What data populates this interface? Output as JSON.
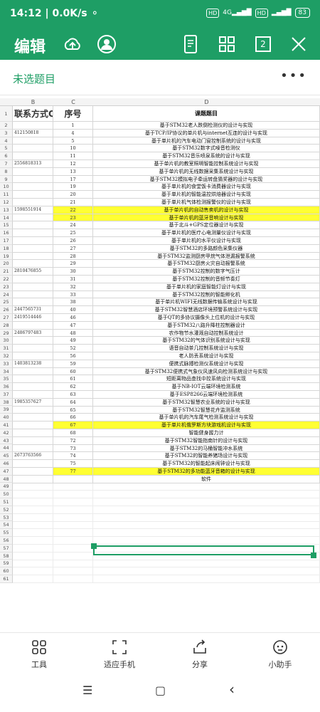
{
  "status": {
    "time": "14:12",
    "speed": "0.0K/s",
    "net1": "HD",
    "net2": "HD",
    "signal": "4G",
    "battery": "83"
  },
  "toolbar": {
    "title": "编辑",
    "page_count": "2"
  },
  "subbar": {
    "title": "未选题目",
    "more": "•••"
  },
  "columns": {
    "B": "B",
    "C": "C",
    "D": "D"
  },
  "row_numbers": [
    "1",
    "2",
    "3",
    "4",
    "5",
    "6",
    "7",
    "8",
    "9",
    "10",
    "11",
    "12",
    "13",
    "14",
    "15",
    "16",
    "17",
    "18",
    "19",
    "20",
    "21",
    "22",
    "23",
    "24",
    "25",
    "26",
    "27",
    "28",
    "29",
    "30",
    "31",
    "32",
    "33",
    "34",
    "35",
    "36",
    "37",
    "38",
    "39",
    "40",
    "41",
    "42",
    "43",
    "44",
    "45",
    "46",
    "47",
    "48",
    "49",
    "50",
    "51",
    "52",
    "53",
    "54",
    "55",
    "56",
    "57",
    "58",
    "59",
    "60",
    "61"
  ],
  "header": {
    "qq": "联系方式QQ",
    "seq": "序号",
    "topic": "课题题目"
  },
  "rows": [
    {
      "qq": "",
      "seq": "1",
      "topic": "基于STM32老人跌倒检测仪的设计与实现",
      "hl": false
    },
    {
      "qq": "412150818",
      "seq": "4",
      "topic": "基于TCP/IP协议的单片机与internet互连的设计与实现",
      "hl": false
    },
    {
      "qq": "",
      "seq": "5",
      "topic": "基于单片机的汽车电动门窗控制系统的设计与实现",
      "hl": false
    },
    {
      "qq": "",
      "seq": "10",
      "topic": "基于STM32数字式噪音检测仪",
      "hl": false
    },
    {
      "qq": "",
      "seq": "11",
      "topic": "基于STM32音乐喷泉系统的设计与实现",
      "hl": false
    },
    {
      "qq": "2556818313",
      "seq": "12",
      "topic": "基于单片机的教室照明智能控制系统设计与实现",
      "hl": false
    },
    {
      "qq": "",
      "seq": "13",
      "topic": "基于单片机的无线数据采集系统设计与实现",
      "hl": false
    },
    {
      "qq": "",
      "seq": "17",
      "topic": "基于STM32模拟电子牵运转盘猜奖器的设计与实现",
      "hl": false
    },
    {
      "qq": "",
      "seq": "19",
      "topic": "基于单片机的食堂饭卡消费器设计与实现",
      "hl": false
    },
    {
      "qq": "",
      "seq": "20",
      "topic": "基于单片机的智能温控烘焙器设计与实现",
      "hl": false
    },
    {
      "qq": "",
      "seq": "21",
      "topic": "基于单片机气体检测报警仪的设计与实现",
      "hl": false
    },
    {
      "qq": "1598551914",
      "seq": "22",
      "topic": "基于单片机的自动售卖机的设计与实现",
      "hl": true
    },
    {
      "qq": "",
      "seq": "23",
      "topic": "基于单片机的蓝牙音响设计与实现",
      "hl": true
    },
    {
      "qq": "",
      "seq": "24",
      "topic": "基于北斗+GPS定位器设计与实现",
      "hl": false
    },
    {
      "qq": "",
      "seq": "25",
      "topic": "基于单片机的医疗心电测量仪设计与实现",
      "hl": false
    },
    {
      "qq": "",
      "seq": "26",
      "topic": "基于单片机的水平仪设计与实现",
      "hl": false
    },
    {
      "qq": "",
      "seq": "27",
      "topic": "基于STM32的多路颜色采集仪器",
      "hl": false
    },
    {
      "qq": "",
      "seq": "28",
      "topic": "基于STM32监测厨房甲烷气体泄漏报警系统",
      "hl": false
    },
    {
      "qq": "",
      "seq": "29",
      "topic": "基于STM32厨房火灾自动报警系统",
      "hl": false
    },
    {
      "qq": "2810476855",
      "seq": "30",
      "topic": "基于STM32控制的数字气压计",
      "hl": false
    },
    {
      "qq": "",
      "seq": "31",
      "topic": "基于STM32控制的音频节奏灯",
      "hl": false
    },
    {
      "qq": "",
      "seq": "32",
      "topic": "基于单片机的家庭智能灯设计与实现",
      "hl": false
    },
    {
      "qq": "",
      "seq": "33",
      "topic": "基于STM32控制的智能孵化机",
      "hl": false
    },
    {
      "qq": "",
      "seq": "38",
      "topic": "基于单片机WIFI无线数据传输系统设计与实现",
      "hl": false
    },
    {
      "qq": "2447565731",
      "seq": "40",
      "topic": "基于STM32智慧酒店环境预警系统设计与实现",
      "hl": false
    },
    {
      "qq": "2419514446",
      "seq": "46",
      "topic": "基于QT的多协议摄像头上位机的设计与实现",
      "hl": false
    },
    {
      "qq": "",
      "seq": "47",
      "topic": "基于STM32八路升降柱控制器设计",
      "hl": false
    },
    {
      "qq": "2486797483",
      "seq": "48",
      "topic": "农作物节水灌溉自动控制系统设计",
      "hl": false
    },
    {
      "qq": "",
      "seq": "49",
      "topic": "基于STM32的气体识别系统设计与实现",
      "hl": false
    },
    {
      "qq": "",
      "seq": "52",
      "topic": "语音自动茶几控制系统设计与实现",
      "hl": false
    },
    {
      "qq": "",
      "seq": "56",
      "topic": "老人防丢系统设计与实现",
      "hl": false
    },
    {
      "qq": "1403813238",
      "seq": "59",
      "topic": "便携式脉搏检测仪系统设计与实现",
      "hl": false
    },
    {
      "qq": "",
      "seq": "60",
      "topic": "基于STM32便携式气象仪风速风向检测系统设计与实现",
      "hl": false
    },
    {
      "qq": "",
      "seq": "61",
      "topic": "短距离物品查找中控系统设计与实现",
      "hl": false
    },
    {
      "qq": "",
      "seq": "62",
      "topic": "基于NB-IOT云端环境检测系统",
      "hl": false
    },
    {
      "qq": "",
      "seq": "63",
      "topic": "基于ESP8266云端环境检测系统",
      "hl": false
    },
    {
      "qq": "1985357627",
      "seq": "64",
      "topic": "基于STM32智慧农业系统的设计与实现",
      "hl": false
    },
    {
      "qq": "",
      "seq": "65",
      "topic": "基于STM32智慧花卉监测系统",
      "hl": false
    },
    {
      "qq": "",
      "seq": "66",
      "topic": "基于单片机的汽车尾气检测系统设计与实现",
      "hl": false
    },
    {
      "qq": "",
      "seq": "67",
      "topic": "基于单片机俄罗斯方块游戏机设计与实现",
      "hl": true
    },
    {
      "qq": "",
      "seq": "68",
      "topic": "智能健身握力计",
      "hl": false
    },
    {
      "qq": "",
      "seq": "72",
      "topic": "基于STM32智能指南针的设计与实现",
      "hl": false
    },
    {
      "qq": "",
      "seq": "73",
      "topic": "基于STM32的马桶智能冲水系统",
      "hl": false
    },
    {
      "qq": "2673763566",
      "seq": "74",
      "topic": "基于STM32的智能养猪场设计与实现",
      "hl": false
    },
    {
      "qq": "",
      "seq": "75",
      "topic": "基于STM32的智能起床闹钟设计与实现",
      "hl": false
    },
    {
      "qq": "",
      "seq": "77",
      "topic": "基于STM32的多功能蓝牙音箱的设计与实现",
      "hl": true
    },
    {
      "qq": "",
      "seq": "",
      "topic": "软件",
      "hl": false
    }
  ],
  "bottom": {
    "tools": "工具",
    "fit": "适应手机",
    "share": "分享",
    "assistant": "小助手"
  },
  "nav": {
    "menu": "☰",
    "home": "▢",
    "back": "‹"
  }
}
